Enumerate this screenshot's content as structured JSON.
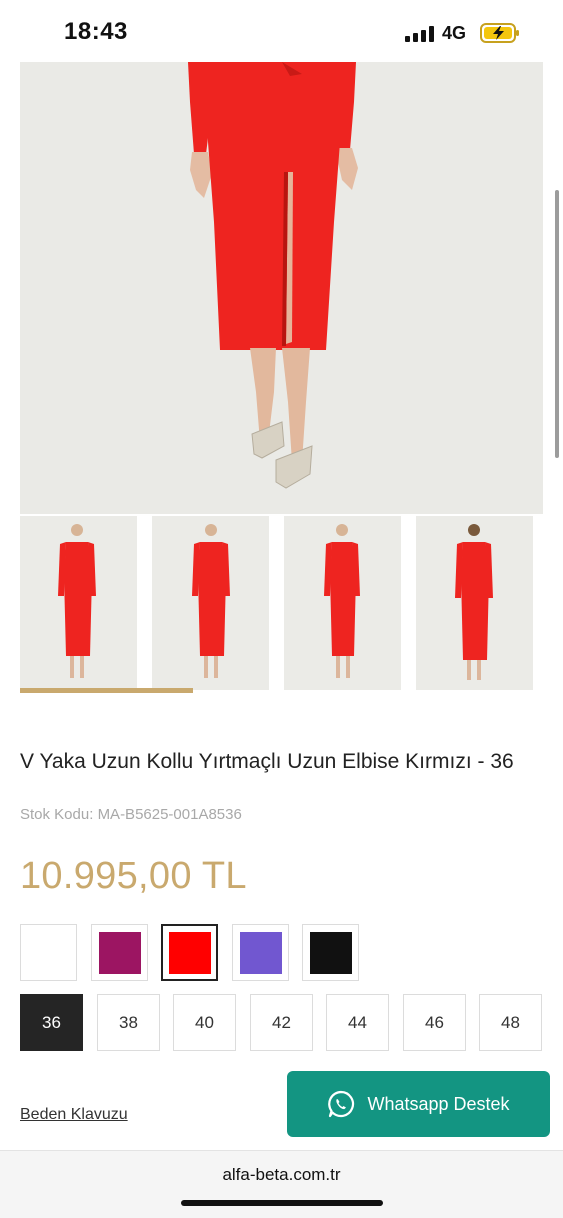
{
  "status_bar": {
    "time": "18:43",
    "network": "4G"
  },
  "product": {
    "title": "V Yaka Uzun Kollu Yırtmaçlı Uzun Elbise Kırmızı - 36",
    "sku_label": "Stok Kodu:",
    "sku_value": "MA-B5625-001A8536",
    "price": "10.995,00 TL",
    "thumbnails_progress": 0.33
  },
  "colors": [
    {
      "name": "white",
      "hex": "#ffffff"
    },
    {
      "name": "magenta",
      "hex": "#9c1562"
    },
    {
      "name": "red",
      "hex": "#ff0000",
      "selected": true
    },
    {
      "name": "purple",
      "hex": "#7157d0"
    },
    {
      "name": "black",
      "hex": "#111111"
    }
  ],
  "sizes": [
    "36",
    "38",
    "40",
    "42",
    "44",
    "46",
    "48"
  ],
  "selected_size": "36",
  "size_guide": "Beden Klavuzu",
  "whatsapp": {
    "label": "Whatsapp Destek"
  },
  "browser": {
    "url": "alfa-beta.com.tr"
  },
  "theme": {
    "accent": "#c9a96e",
    "whatsapp": "#139582",
    "dress": "#ee2420"
  }
}
